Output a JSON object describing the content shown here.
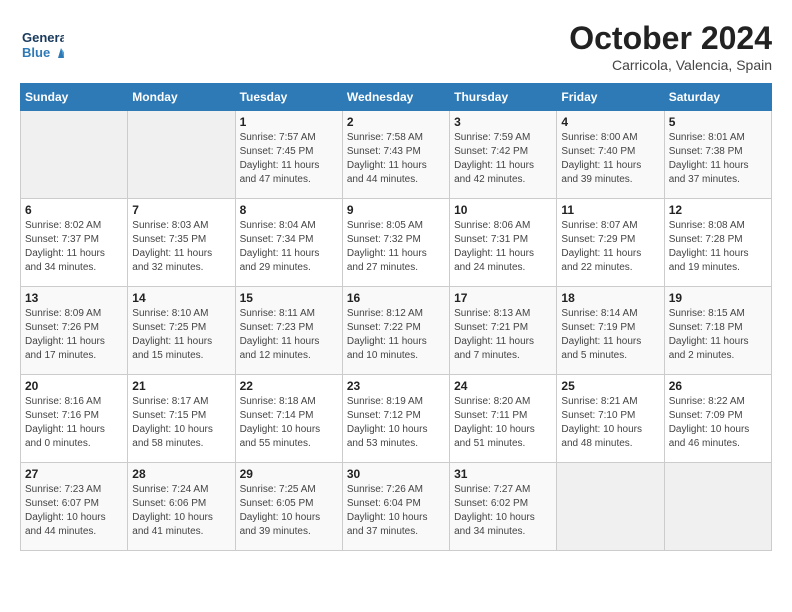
{
  "header": {
    "logo_general": "General",
    "logo_blue": "Blue",
    "month_year": "October 2024",
    "location": "Carricola, Valencia, Spain"
  },
  "weekdays": [
    "Sunday",
    "Monday",
    "Tuesday",
    "Wednesday",
    "Thursday",
    "Friday",
    "Saturday"
  ],
  "weeks": [
    [
      {
        "day": "",
        "info": ""
      },
      {
        "day": "",
        "info": ""
      },
      {
        "day": "1",
        "info": "Sunrise: 7:57 AM\nSunset: 7:45 PM\nDaylight: 11 hours and 47 minutes."
      },
      {
        "day": "2",
        "info": "Sunrise: 7:58 AM\nSunset: 7:43 PM\nDaylight: 11 hours and 44 minutes."
      },
      {
        "day": "3",
        "info": "Sunrise: 7:59 AM\nSunset: 7:42 PM\nDaylight: 11 hours and 42 minutes."
      },
      {
        "day": "4",
        "info": "Sunrise: 8:00 AM\nSunset: 7:40 PM\nDaylight: 11 hours and 39 minutes."
      },
      {
        "day": "5",
        "info": "Sunrise: 8:01 AM\nSunset: 7:38 PM\nDaylight: 11 hours and 37 minutes."
      }
    ],
    [
      {
        "day": "6",
        "info": "Sunrise: 8:02 AM\nSunset: 7:37 PM\nDaylight: 11 hours and 34 minutes."
      },
      {
        "day": "7",
        "info": "Sunrise: 8:03 AM\nSunset: 7:35 PM\nDaylight: 11 hours and 32 minutes."
      },
      {
        "day": "8",
        "info": "Sunrise: 8:04 AM\nSunset: 7:34 PM\nDaylight: 11 hours and 29 minutes."
      },
      {
        "day": "9",
        "info": "Sunrise: 8:05 AM\nSunset: 7:32 PM\nDaylight: 11 hours and 27 minutes."
      },
      {
        "day": "10",
        "info": "Sunrise: 8:06 AM\nSunset: 7:31 PM\nDaylight: 11 hours and 24 minutes."
      },
      {
        "day": "11",
        "info": "Sunrise: 8:07 AM\nSunset: 7:29 PM\nDaylight: 11 hours and 22 minutes."
      },
      {
        "day": "12",
        "info": "Sunrise: 8:08 AM\nSunset: 7:28 PM\nDaylight: 11 hours and 19 minutes."
      }
    ],
    [
      {
        "day": "13",
        "info": "Sunrise: 8:09 AM\nSunset: 7:26 PM\nDaylight: 11 hours and 17 minutes."
      },
      {
        "day": "14",
        "info": "Sunrise: 8:10 AM\nSunset: 7:25 PM\nDaylight: 11 hours and 15 minutes."
      },
      {
        "day": "15",
        "info": "Sunrise: 8:11 AM\nSunset: 7:23 PM\nDaylight: 11 hours and 12 minutes."
      },
      {
        "day": "16",
        "info": "Sunrise: 8:12 AM\nSunset: 7:22 PM\nDaylight: 11 hours and 10 minutes."
      },
      {
        "day": "17",
        "info": "Sunrise: 8:13 AM\nSunset: 7:21 PM\nDaylight: 11 hours and 7 minutes."
      },
      {
        "day": "18",
        "info": "Sunrise: 8:14 AM\nSunset: 7:19 PM\nDaylight: 11 hours and 5 minutes."
      },
      {
        "day": "19",
        "info": "Sunrise: 8:15 AM\nSunset: 7:18 PM\nDaylight: 11 hours and 2 minutes."
      }
    ],
    [
      {
        "day": "20",
        "info": "Sunrise: 8:16 AM\nSunset: 7:16 PM\nDaylight: 11 hours and 0 minutes."
      },
      {
        "day": "21",
        "info": "Sunrise: 8:17 AM\nSunset: 7:15 PM\nDaylight: 10 hours and 58 minutes."
      },
      {
        "day": "22",
        "info": "Sunrise: 8:18 AM\nSunset: 7:14 PM\nDaylight: 10 hours and 55 minutes."
      },
      {
        "day": "23",
        "info": "Sunrise: 8:19 AM\nSunset: 7:12 PM\nDaylight: 10 hours and 53 minutes."
      },
      {
        "day": "24",
        "info": "Sunrise: 8:20 AM\nSunset: 7:11 PM\nDaylight: 10 hours and 51 minutes."
      },
      {
        "day": "25",
        "info": "Sunrise: 8:21 AM\nSunset: 7:10 PM\nDaylight: 10 hours and 48 minutes."
      },
      {
        "day": "26",
        "info": "Sunrise: 8:22 AM\nSunset: 7:09 PM\nDaylight: 10 hours and 46 minutes."
      }
    ],
    [
      {
        "day": "27",
        "info": "Sunrise: 7:23 AM\nSunset: 6:07 PM\nDaylight: 10 hours and 44 minutes."
      },
      {
        "day": "28",
        "info": "Sunrise: 7:24 AM\nSunset: 6:06 PM\nDaylight: 10 hours and 41 minutes."
      },
      {
        "day": "29",
        "info": "Sunrise: 7:25 AM\nSunset: 6:05 PM\nDaylight: 10 hours and 39 minutes."
      },
      {
        "day": "30",
        "info": "Sunrise: 7:26 AM\nSunset: 6:04 PM\nDaylight: 10 hours and 37 minutes."
      },
      {
        "day": "31",
        "info": "Sunrise: 7:27 AM\nSunset: 6:02 PM\nDaylight: 10 hours and 34 minutes."
      },
      {
        "day": "",
        "info": ""
      },
      {
        "day": "",
        "info": ""
      }
    ]
  ]
}
